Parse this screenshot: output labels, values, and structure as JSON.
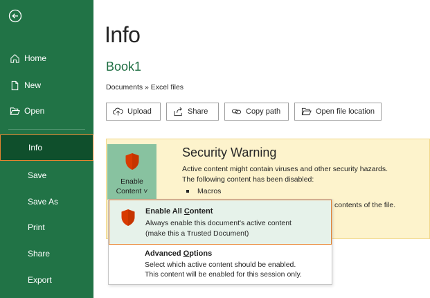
{
  "sidebar": {
    "items": [
      {
        "label": "Home",
        "icon": "home-icon"
      },
      {
        "label": "New",
        "icon": "new-document-icon"
      },
      {
        "label": "Open",
        "icon": "folder-open-icon"
      },
      {
        "label": "Info",
        "selected": true
      },
      {
        "label": "Save"
      },
      {
        "label": "Save As"
      },
      {
        "label": "Print"
      },
      {
        "label": "Share"
      },
      {
        "label": "Export"
      }
    ]
  },
  "main": {
    "title": "Info",
    "workbook_name": "Book1",
    "breadcrumb": "Documents » Excel files",
    "buttons": [
      {
        "label": "Upload",
        "icon": "upload-cloud-icon"
      },
      {
        "label": "Share",
        "icon": "share-icon"
      },
      {
        "label": "Copy path",
        "icon": "link-icon"
      },
      {
        "label": "Open file location",
        "icon": "folder-icon"
      }
    ]
  },
  "security": {
    "title": "Security Warning",
    "line1": "Active content might contain viruses and other security hazards.",
    "line2": "The following content has been disabled:",
    "bullet": "Macros",
    "trailing_text": "contents of the file.",
    "enable_button": {
      "line1": "Enable",
      "line2": "Content ˅"
    }
  },
  "dropdown": {
    "option1": {
      "title_prefix": "Enable All ",
      "title_access": "C",
      "title_suffix": "ontent",
      "line1": "Always enable this document's active content",
      "line2": "(make this a Trusted Document)"
    },
    "option2": {
      "title_prefix": "Advanced ",
      "title_access": "O",
      "title_suffix": "ptions",
      "line1": "Select which active content should be enabled.",
      "line2": "This content will be enabled for this session only."
    }
  },
  "colors": {
    "sidebar_bg": "#217346",
    "selected_bg": "#0f4f2c",
    "accent_border": "#e8832e",
    "warning_bg": "#fdf3cc",
    "shield_red": "#d83b01"
  }
}
